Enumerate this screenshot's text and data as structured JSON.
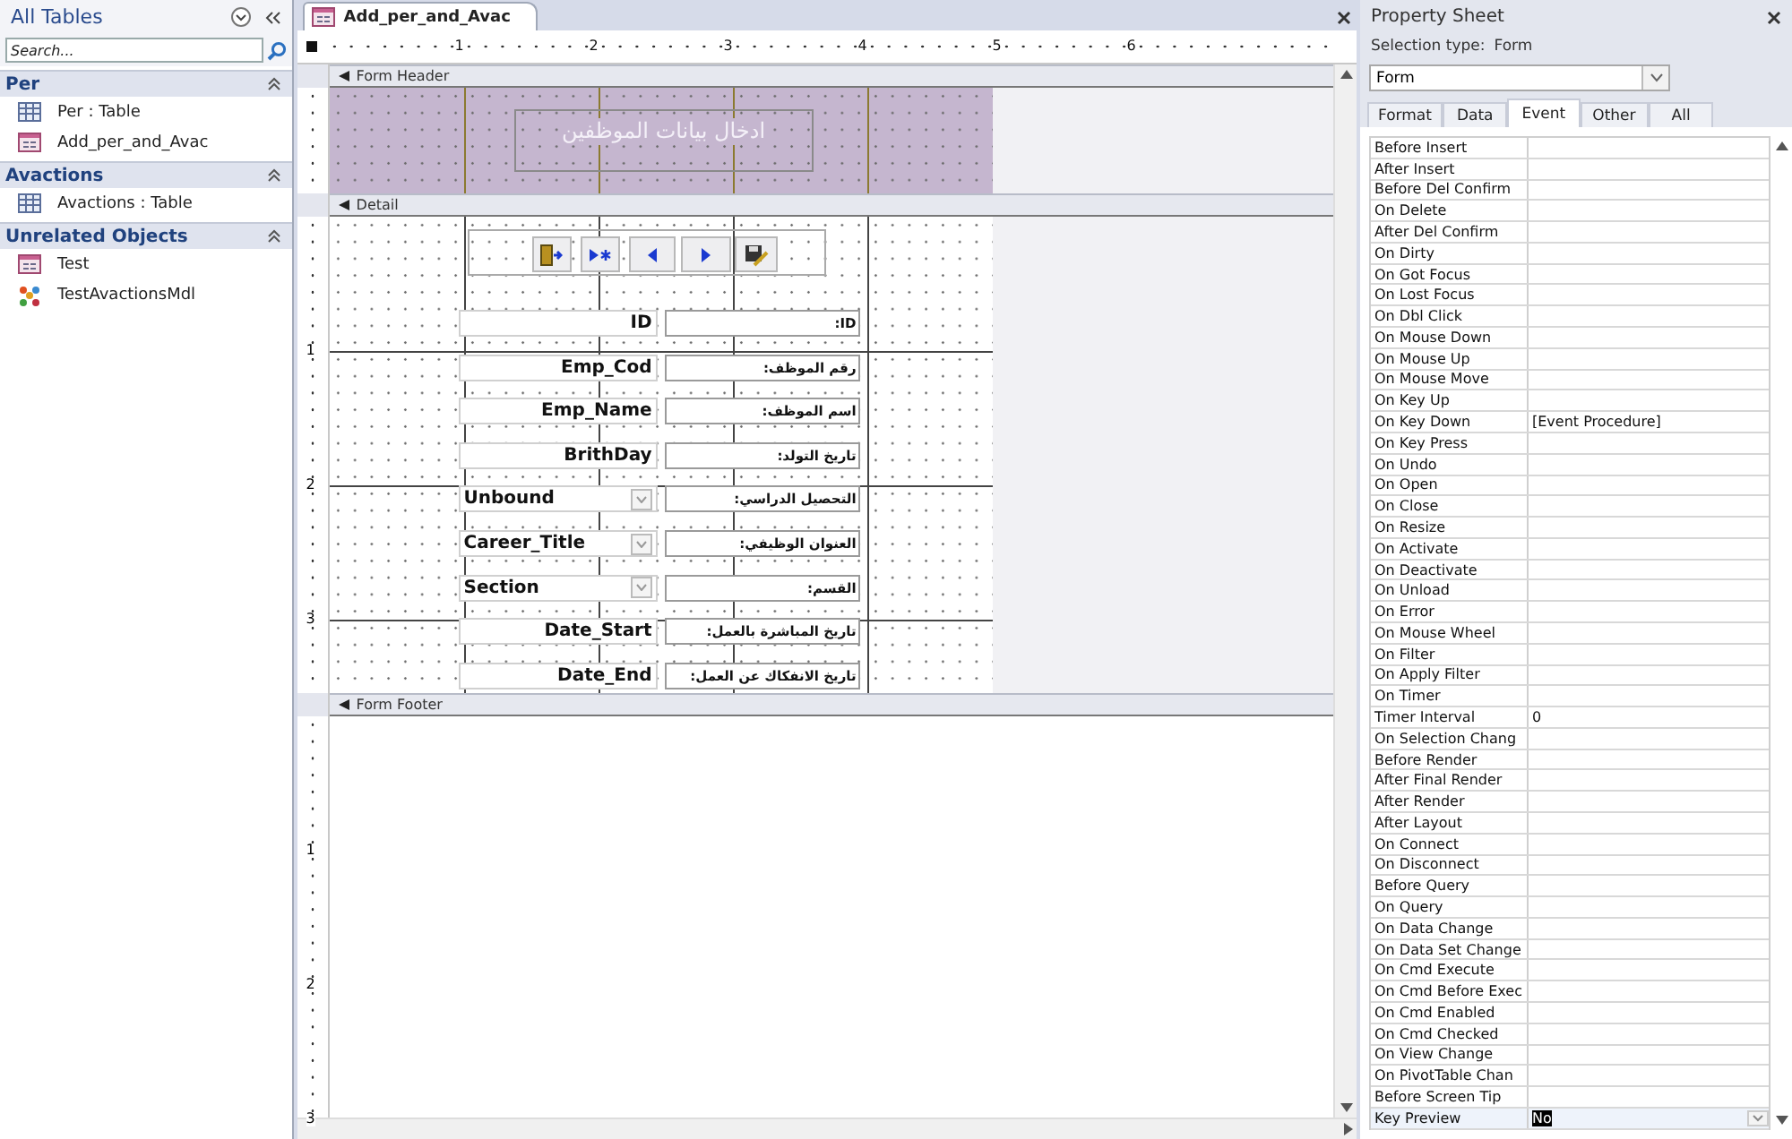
{
  "navigation_pane": {
    "title": "All Tables",
    "search": {
      "placeholder": "Search..."
    },
    "groups": [
      {
        "name": "Per",
        "expanded": true,
        "items": [
          {
            "label": "Per : Table",
            "kind": "table"
          },
          {
            "label": "Add_per_and_Avac",
            "kind": "form"
          }
        ]
      },
      {
        "name": "Avactions",
        "expanded": true,
        "items": [
          {
            "label": "Avactions : Table",
            "kind": "table"
          }
        ]
      },
      {
        "name": "Unrelated Objects",
        "expanded": true,
        "items": [
          {
            "label": "Test",
            "kind": "form"
          },
          {
            "label": "TestAvactionsMdl",
            "kind": "macro"
          }
        ]
      }
    ]
  },
  "document_tab": {
    "title": "Add_per_and_Avac"
  },
  "ruler": {
    "marks": [
      "1",
      "2",
      "3",
      "4",
      "5",
      "6"
    ]
  },
  "form": {
    "sections": [
      {
        "title": "Form Header",
        "kind": "header"
      },
      {
        "title": "Detail",
        "kind": "detail",
        "ruler_marks": [
          "1",
          "2",
          "3"
        ]
      },
      {
        "title": "Form Footer",
        "kind": "footer",
        "ruler_marks": [
          "1",
          "2",
          "3"
        ]
      }
    ],
    "header_label": "ادخال بيانات الموظفين",
    "nav_buttons": [
      {
        "kind": "exit"
      },
      {
        "kind": "new"
      },
      {
        "kind": "previous"
      },
      {
        "kind": "next"
      },
      {
        "kind": "save"
      }
    ],
    "fields": [
      {
        "label": "ID:",
        "control": "ID",
        "kind": "textbox"
      },
      {
        "label": "رقم الموظف:",
        "control": "Emp_Cod",
        "kind": "textbox"
      },
      {
        "label": "اسم الموظف:",
        "control": "Emp_Name",
        "kind": "textbox"
      },
      {
        "label": "تاريخ التولد:",
        "control": "BrithDay",
        "kind": "textbox"
      },
      {
        "label": "التحصيل الدراسي:",
        "control": "Unbound",
        "kind": "combo"
      },
      {
        "label": "العنوان الوظيفي:",
        "control": "Career_Title",
        "kind": "combo"
      },
      {
        "label": "القسم:",
        "control": "Section",
        "kind": "combo"
      },
      {
        "label": "تاريخ المباشرة بالعمل:",
        "control": "Date_Start",
        "kind": "textbox"
      },
      {
        "label": "تاريخ الانفكاك عن العمل:",
        "control": "Date_End",
        "kind": "textbox"
      }
    ]
  },
  "property_sheet": {
    "title": "Property Sheet",
    "selection_type_label": "Selection type:",
    "selection_type": "Form",
    "object": "Form",
    "tabs": [
      {
        "label": "Format",
        "selected": false
      },
      {
        "label": "Data",
        "selected": false
      },
      {
        "label": "Event",
        "selected": true
      },
      {
        "label": "Other",
        "selected": false
      },
      {
        "label": "All",
        "selected": false
      }
    ],
    "properties": [
      {
        "name": "Before Insert",
        "selected": false
      },
      {
        "name": "After Insert",
        "selected": false
      },
      {
        "name": "Before Del Confirm",
        "selected": false
      },
      {
        "name": "On Delete",
        "selected": false
      },
      {
        "name": "After Del Confirm",
        "selected": false
      },
      {
        "name": "On Dirty",
        "selected": false
      },
      {
        "name": "On Got Focus",
        "selected": false
      },
      {
        "name": "On Lost Focus",
        "selected": false
      },
      {
        "name": "On Dbl Click",
        "selected": false
      },
      {
        "name": "On Mouse Down",
        "selected": false
      },
      {
        "name": "On Mouse Up",
        "selected": false
      },
      {
        "name": "On Mouse Move",
        "selected": false
      },
      {
        "name": "On Key Up",
        "selected": false
      },
      {
        "name": "On Key Down",
        "value": "[Event Procedure]",
        "selected": false
      },
      {
        "name": "On Key Press",
        "selected": false
      },
      {
        "name": "On Undo",
        "selected": false
      },
      {
        "name": "On Open",
        "selected": false
      },
      {
        "name": "On Close",
        "selected": false
      },
      {
        "name": "On Resize",
        "selected": false
      },
      {
        "name": "On Activate",
        "selected": false
      },
      {
        "name": "On Deactivate",
        "selected": false
      },
      {
        "name": "On Unload",
        "selected": false
      },
      {
        "name": "On Error",
        "selected": false
      },
      {
        "name": "On Mouse Wheel",
        "selected": false
      },
      {
        "name": "On Filter",
        "selected": false
      },
      {
        "name": "On Apply Filter",
        "selected": false
      },
      {
        "name": "On Timer",
        "selected": false
      },
      {
        "name": "Timer Interval",
        "value": "0",
        "selected": false
      },
      {
        "name": "On Selection Chang",
        "selected": false
      },
      {
        "name": "Before Render",
        "selected": false
      },
      {
        "name": "After Final Render",
        "selected": false
      },
      {
        "name": "After Render",
        "selected": false
      },
      {
        "name": "After Layout",
        "selected": false
      },
      {
        "name": "On Connect",
        "selected": false
      },
      {
        "name": "On Disconnect",
        "selected": false
      },
      {
        "name": "Before Query",
        "selected": false
      },
      {
        "name": "On Query",
        "selected": false
      },
      {
        "name": "On Data Change",
        "selected": false
      },
      {
        "name": "On Data Set Change",
        "selected": false
      },
      {
        "name": "On Cmd Execute",
        "selected": false
      },
      {
        "name": "On Cmd Before Exec",
        "selected": false
      },
      {
        "name": "On Cmd Enabled",
        "selected": false
      },
      {
        "name": "On Cmd Checked",
        "selected": false
      },
      {
        "name": "On View Change",
        "selected": false
      },
      {
        "name": "On PivotTable Chan",
        "selected": false
      },
      {
        "name": "Before Screen Tip",
        "selected": false
      },
      {
        "name": "Key Preview",
        "value": "No",
        "selected": true
      }
    ]
  }
}
